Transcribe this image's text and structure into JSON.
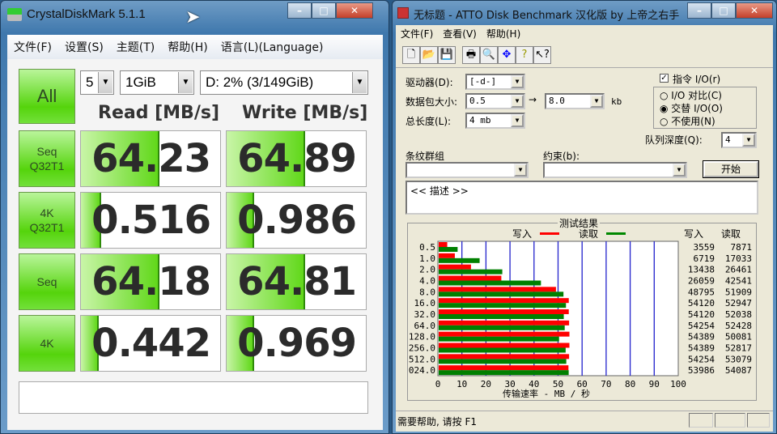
{
  "cdm": {
    "title": "CrystalDiskMark 5.1.1",
    "menu": [
      "文件(F)",
      "设置(S)",
      "主题(T)",
      "帮助(H)",
      "语言(L)(Language)"
    ],
    "all_label": "All",
    "count": "5",
    "size": "1GiB",
    "drive": "D: 2% (3/149GiB)",
    "read_header": "Read [MB/s]",
    "write_header": "Write [MB/s]",
    "rows": [
      {
        "label1": "Seq",
        "label2": "Q32T1",
        "read": "64.23",
        "write": "64.89"
      },
      {
        "label1": "4K",
        "label2": "Q32T1",
        "read": "0.516",
        "write": "0.986"
      },
      {
        "label1": "Seq",
        "label2": "",
        "read": "64.18",
        "write": "64.81"
      },
      {
        "label1": "4K",
        "label2": "",
        "read": "0.442",
        "write": "0.969"
      }
    ],
    "comment": ""
  },
  "atto": {
    "title": "无标题 - ATTO Disk Benchmark  汉化版 by 上帝之右手",
    "menu": [
      "文件(F)",
      "查看(V)",
      "帮助(H)"
    ],
    "drive_label": "驱动器(D):",
    "drive": "[-d-]",
    "packet_label": "数据包大小:",
    "packet_from": "0.5",
    "arrow": "→",
    "packet_to": "8.0",
    "kb": "kb",
    "length_label": "总长度(L):",
    "length": "4 mb",
    "direct_io": "指令 I/O(r)",
    "radios": [
      "I/O 对比(C)",
      "交替 I/O(O)",
      "不使用(N)"
    ],
    "queue_label": "队列深度(Q):",
    "queue": "4",
    "stripe_label": "条纹群组",
    "constraint_label": "约束(b):",
    "start": "开始",
    "description": "<< 描述 >>",
    "results_title": "测试结果",
    "legend_write": "写入",
    "legend_read": "读取",
    "col_write": "写入",
    "col_read": "读取",
    "status": "需要帮助, 请按 F1"
  },
  "chart_data": {
    "type": "bar",
    "title": "测试结果",
    "xlabel": "传输速率 - MB / 秒",
    "xlim": [
      0,
      100
    ],
    "xticks": [
      "0",
      "10",
      "20",
      "30",
      "40",
      "50",
      "60",
      "70",
      "80",
      "90",
      "100"
    ],
    "categories": [
      "0.5",
      "1.0",
      "2.0",
      "4.0",
      "8.0",
      "16.0",
      "32.0",
      "64.0",
      "128.0",
      "256.0",
      "512.0",
      "024.0"
    ],
    "series": [
      {
        "name": "写入",
        "color": "#ff0000",
        "values": [
          3559,
          6719,
          13438,
          26059,
          48795,
          54120,
          54120,
          54254,
          54389,
          54389,
          54254,
          53986
        ]
      },
      {
        "name": "读取",
        "color": "#008000",
        "values": [
          7871,
          17033,
          26461,
          42541,
          51909,
          52947,
          52038,
          52428,
          50081,
          52817,
          53079,
          54087
        ]
      }
    ]
  }
}
